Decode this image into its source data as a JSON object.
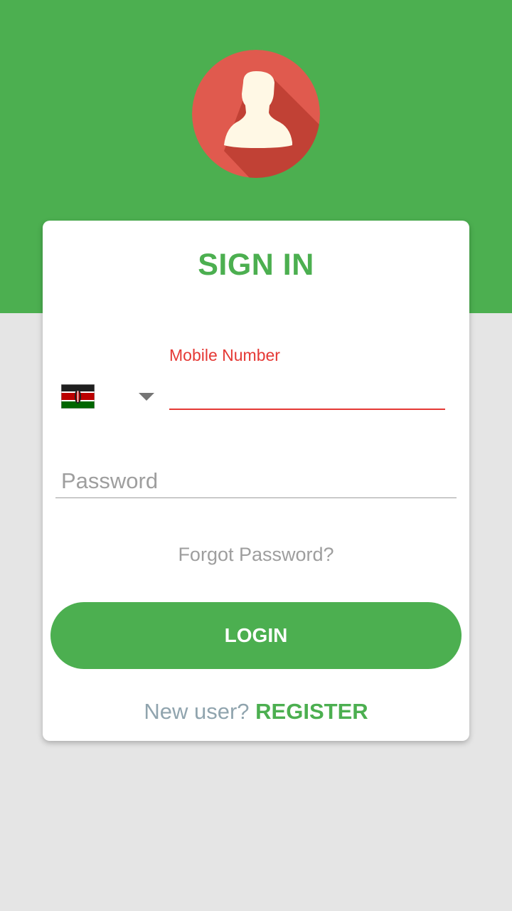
{
  "colors": {
    "brand_green": "#4caf50",
    "error_red": "#e53935",
    "avatar_red": "#e05a4e",
    "background_gray": "#e5e5e5"
  },
  "header": {
    "avatar_icon": "user-avatar-icon"
  },
  "form": {
    "title": "SIGN IN",
    "mobile": {
      "label": "Mobile Number",
      "value": "",
      "country_flag": "kenya-flag-icon",
      "country_dropdown_icon": "caret-down-icon"
    },
    "password": {
      "placeholder": "Password",
      "value": ""
    },
    "forgot_password": "Forgot Password?",
    "login_button": "LOGIN",
    "new_user_text": "New user?",
    "register_link": "REGISTER"
  }
}
